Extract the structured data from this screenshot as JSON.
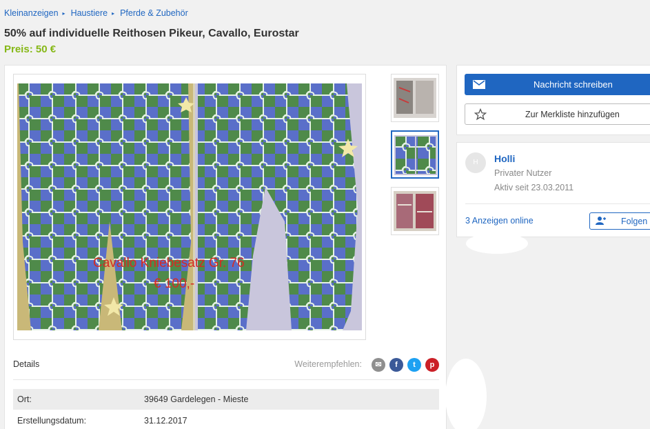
{
  "breadcrumb": {
    "items": [
      "Kleinanzeigen",
      "Haustiere",
      "Pferde & Zubehör"
    ],
    "separator": "▸"
  },
  "listing": {
    "title": "50% auf individuelle Reithosen Pikeur, Cavallo, Eurostar",
    "price": "Preis: 50 €"
  },
  "image": {
    "overlay_line1": "Cavallo Kniebesatz Gr. 76",
    "overlay_line2": "€ 100,-"
  },
  "details": {
    "label": "Details",
    "share_label": "Weiterempfehlen:",
    "rows": [
      {
        "key": "Ort:",
        "value": "39649 Gardelegen - Mieste"
      },
      {
        "key": "Erstellungsdatum:",
        "value": "31.12.2017"
      }
    ]
  },
  "actions": {
    "message_label": "Nachricht schreiben",
    "watchlist_label": "Zur Merkliste hinzufügen"
  },
  "seller": {
    "initial": "H",
    "name": "Holli",
    "type": "Privater Nutzer",
    "active_since": "Aktiv seit 23.03.2011",
    "ads_online": "3 Anzeigen online",
    "follow_label": "Folgen"
  },
  "icons": {
    "email": "envelope-icon",
    "watchlist": "star-icon",
    "follow": "add-user-icon",
    "share": [
      "email-share-icon",
      "facebook-icon",
      "twitter-icon",
      "pinterest-icon"
    ]
  },
  "colors": {
    "accent": "#1f66c1",
    "price": "#86b817",
    "facebook": "#3b5998",
    "twitter": "#1da1f2",
    "pinterest": "#cb2027",
    "email_share": "#8f8f8f"
  }
}
